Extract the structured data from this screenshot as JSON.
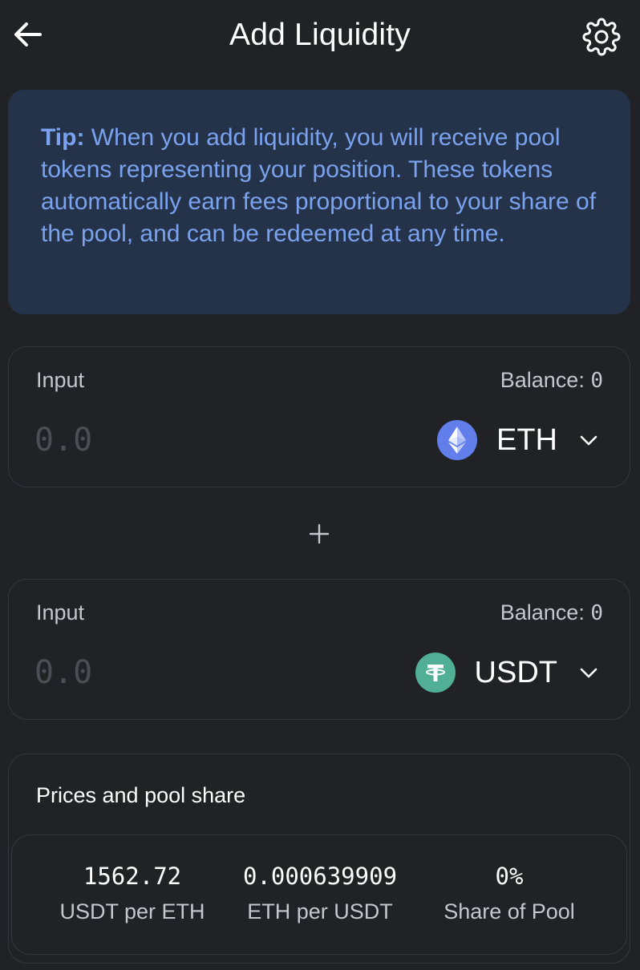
{
  "header": {
    "title": "Add Liquidity"
  },
  "tip": {
    "label": "Tip:",
    "text": " When you add liquidity, you will receive pool tokens representing your position. These tokens automatically earn fees proportional to your share of the pool, and can be redeemed at any time."
  },
  "input_a": {
    "label": "Input",
    "balance_label": "Balance:",
    "balance_value": "0",
    "placeholder": "0.0",
    "token": "ETH",
    "token_icon": "ethereum-icon",
    "token_color": "#627eea"
  },
  "input_b": {
    "label": "Input",
    "balance_label": "Balance:",
    "balance_value": "0",
    "placeholder": "0.0",
    "token": "USDT",
    "token_icon": "tether-icon",
    "token_color": "#50af95"
  },
  "prices": {
    "title": "Prices and pool share",
    "stats": [
      {
        "value": "1562.72",
        "label": "USDT per ETH"
      },
      {
        "value": "0.000639909",
        "label": "ETH per USDT"
      },
      {
        "value": "0%",
        "label": "Share of Pool"
      }
    ]
  },
  "colors": {
    "background": "#212226",
    "tip_bg": "#243349",
    "tip_text": "#7aa2ef",
    "border": "#35373c"
  }
}
